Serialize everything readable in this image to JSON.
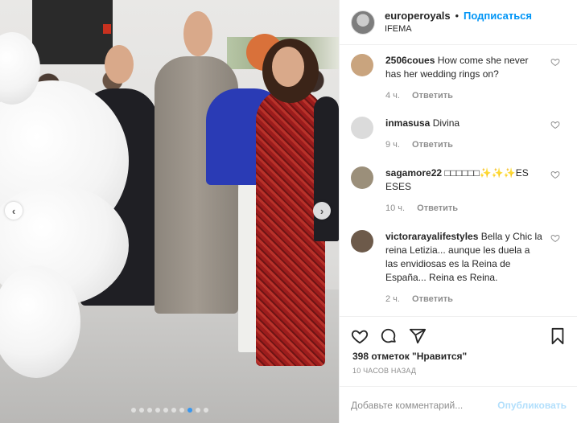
{
  "header": {
    "username": "europeroyals",
    "bullet": "•",
    "follow_label": "Подписаться",
    "location": "IFEMA"
  },
  "comments": [
    {
      "user": "2506coues",
      "text": "How come she never has her wedding rings on?",
      "time": "4 ч.",
      "reply_label": "Ответить",
      "avatar_color": "#c9a47e"
    },
    {
      "user": "inmasusa",
      "text": "Divina",
      "time": "9 ч.",
      "reply_label": "Ответить",
      "avatar_color": "#dbdbdb"
    },
    {
      "user": "sagamore22",
      "text": "□□□□□□✨✨✨ES ESES",
      "time": "10 ч.",
      "reply_label": "Ответить",
      "avatar_color": "#9b8f7a"
    },
    {
      "user": "victorarayalifestyles",
      "text": "Bella y Chic la reina Letizia... aunque les duela a las envidiosas es la Reina de España... Reina es Reina.",
      "time": "2 ч.",
      "reply_label": "Ответить",
      "avatar_color": "#6d5a4a"
    }
  ],
  "actions": {
    "likes": "398 отметок \"Нравится\"",
    "time_ago": "10 ЧАСОВ НАЗАД"
  },
  "add_comment": {
    "placeholder": "Добавьте комментарий...",
    "publish_label": "Опубликовать"
  },
  "carousel": {
    "total_slides": 10,
    "active_slide": 8
  },
  "icons": {
    "like": "heart-icon",
    "comment": "comment-icon",
    "share": "share-icon",
    "save": "bookmark-icon",
    "prev": "chevron-left-icon",
    "next": "chevron-right-icon"
  },
  "colors": {
    "accent": "#0095f6",
    "publish_disabled": "#b2dffc",
    "muted": "#8e8e8e",
    "active_dot": "#3897f0"
  }
}
